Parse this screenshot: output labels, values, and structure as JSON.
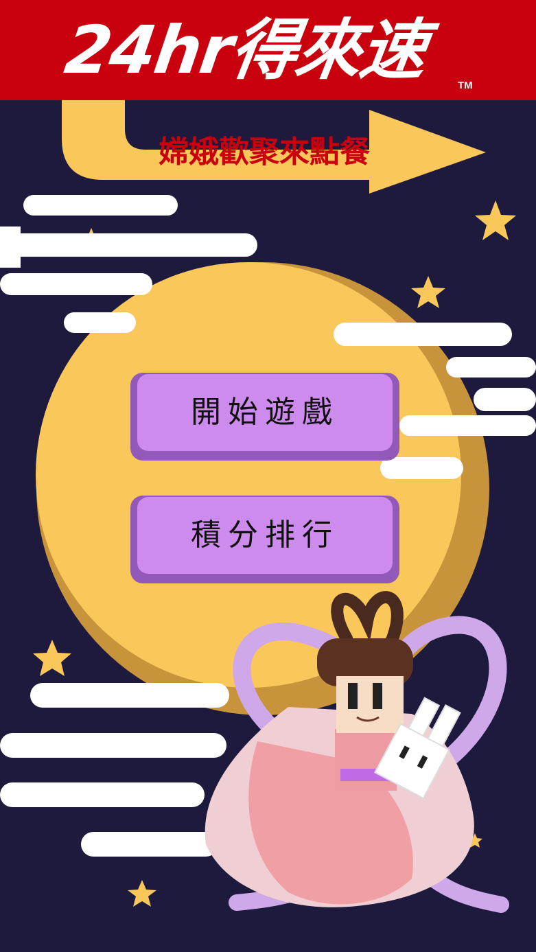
{
  "header": {
    "logo_text": "24hr得來速",
    "trademark": "TM"
  },
  "banner": {
    "subtitle": "嫦娥歡聚來點餐"
  },
  "menu": {
    "start_label": "開始遊戲",
    "ranking_label": "積分排行"
  },
  "colors": {
    "header_red": "#c9000e",
    "night_sky": "#1d1a3e",
    "moon_yellow": "#f9c75a",
    "button_purple": "#cc8bed",
    "button_shadow": "#9359b8"
  }
}
